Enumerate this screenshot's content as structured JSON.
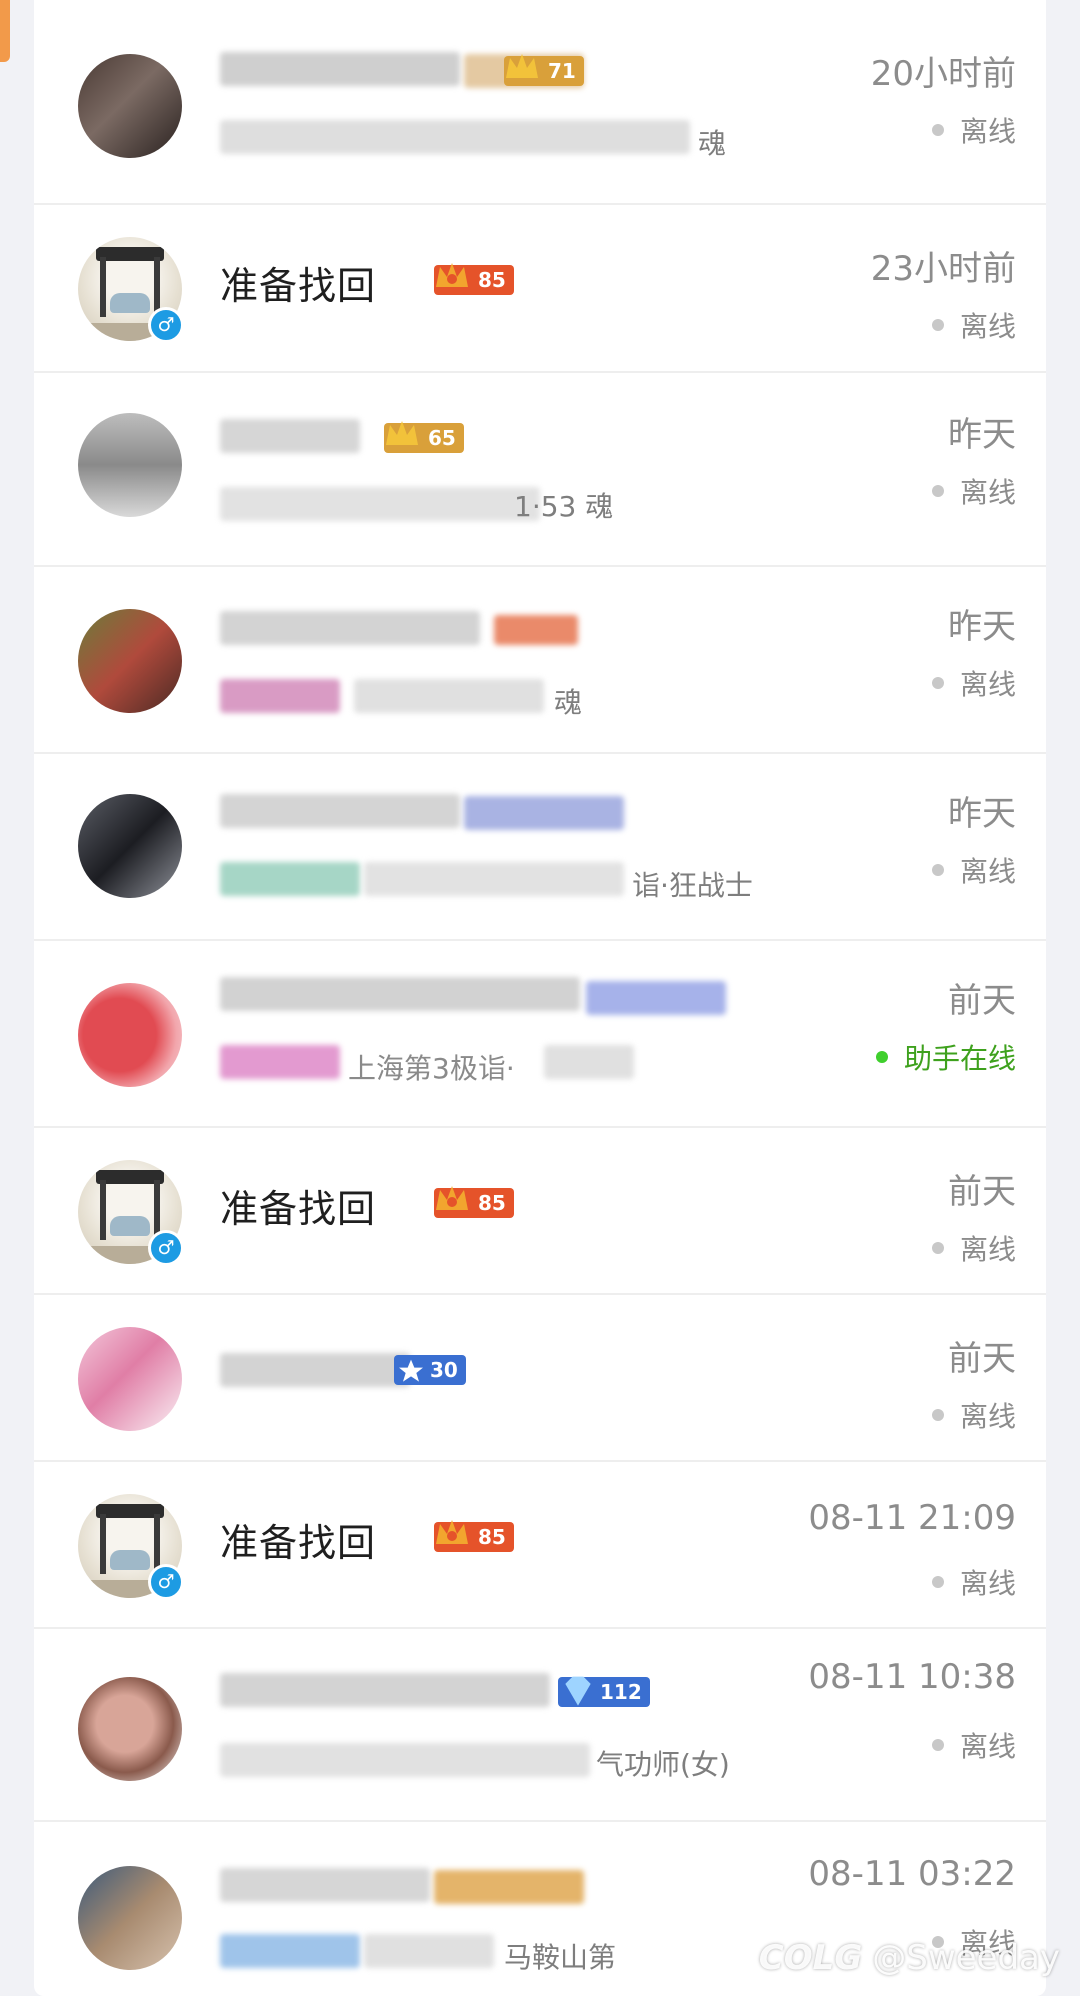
{
  "rows": [
    {
      "name": "",
      "sub": "魂",
      "time": "20小时前",
      "status": "离线",
      "online": false,
      "level": "71",
      "avatar": "blur1"
    },
    {
      "name": "准备找回",
      "sub": "",
      "time": "23小时前",
      "status": "离线",
      "online": false,
      "level": "85",
      "avatar": "car",
      "gender": "♂"
    },
    {
      "name": "",
      "sub": "1·53 魂",
      "time": "昨天",
      "status": "离线",
      "online": false,
      "level": "65",
      "avatar": "blur2"
    },
    {
      "name": "",
      "sub": "魂",
      "time": "昨天",
      "status": "离线",
      "online": false,
      "level": "",
      "avatar": "blur3"
    },
    {
      "name": "",
      "sub": "诣·狂战士",
      "time": "昨天",
      "status": "离线",
      "online": false,
      "level": "",
      "avatar": "blur4"
    },
    {
      "name": "",
      "sub": "上海第3极诣·",
      "time": "前天",
      "status": "助手在线",
      "online": true,
      "level": "",
      "avatar": "blur5"
    },
    {
      "name": "准备找回",
      "sub": "",
      "time": "前天",
      "status": "离线",
      "online": false,
      "level": "85",
      "avatar": "car",
      "gender": "♂"
    },
    {
      "name": "",
      "sub": "",
      "time": "前天",
      "status": "离线",
      "online": false,
      "level": "30",
      "avatar": "blur6"
    },
    {
      "name": "准备找回",
      "sub": "",
      "time": "08-11 21:09",
      "status": "离线",
      "online": false,
      "level": "85",
      "avatar": "car",
      "gender": "♂"
    },
    {
      "name": "",
      "sub": "气功师(女)",
      "time": "08-11 10:38",
      "status": "离线",
      "online": false,
      "level": "112",
      "avatar": "blur7"
    },
    {
      "name": "",
      "sub": "马鞍山第",
      "time": "08-11 03:22",
      "status": "离线",
      "online": false,
      "level": "",
      "avatar": "blur8"
    }
  ],
  "watermark": {
    "logo": "COLG",
    "handle": "@Sweeday"
  },
  "colors": {
    "online": "#3ea11d",
    "offline_dot": "#c8c8c8",
    "accent_badge": "#e5532a"
  }
}
